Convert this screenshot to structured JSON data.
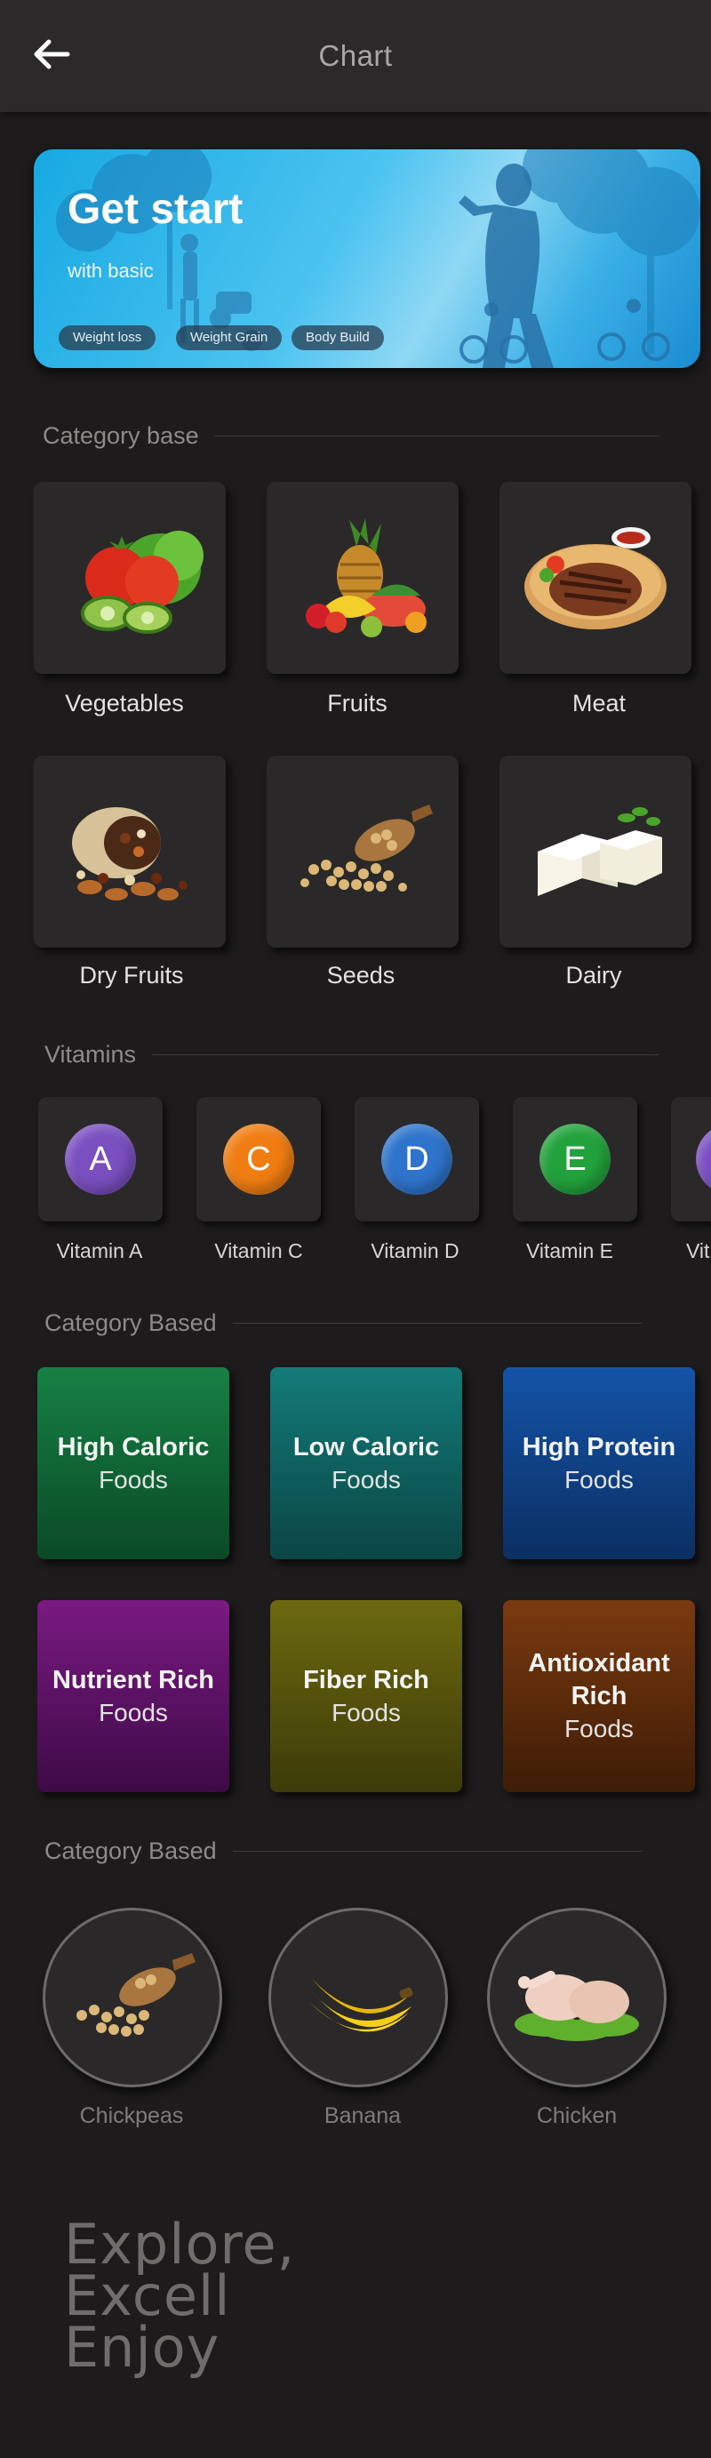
{
  "header": {
    "title": "Chart",
    "back_icon": "arrow-left-icon"
  },
  "banner": {
    "title": "Get start",
    "subtitle": "with basic",
    "chips": [
      "Weight loss",
      "Weight Grain",
      "Body Build"
    ]
  },
  "category_base": {
    "heading": "Category base",
    "items": [
      "Vegetables",
      "Fruits",
      "Meat",
      "Dry Fruits",
      "Seeds",
      "Dairy"
    ]
  },
  "vitamins": {
    "heading": "Vitamins",
    "items": [
      {
        "letter": "A",
        "label": "Vitamin A",
        "color": "#7a4fc0"
      },
      {
        "letter": "C",
        "label": "Vitamin C",
        "color": "#f07d12"
      },
      {
        "letter": "D",
        "label": "Vitamin D",
        "color": "#2f74cc"
      },
      {
        "letter": "E",
        "label": "Vitamin E",
        "color": "#22a23c"
      },
      {
        "letter": "",
        "label": "Vit",
        "color": "#7a4fc0"
      }
    ]
  },
  "category_based_tiles": {
    "heading": "Category Based",
    "tiles": [
      {
        "title": "High Caloric",
        "sub": "Foods",
        "color_top": "#168044",
        "color_bottom": "#0a4a26"
      },
      {
        "title": "Low Caloric",
        "sub": "Foods",
        "color_top": "#137b78",
        "color_bottom": "#0a4645"
      },
      {
        "title": "High Protein",
        "sub": "Foods",
        "color_top": "#1453a8",
        "color_bottom": "#0b2f62"
      },
      {
        "title": "Nutrient Rich",
        "sub": "Foods",
        "color_top": "#7a1a82",
        "color_bottom": "#3d0a45"
      },
      {
        "title": "Fiber Rich",
        "sub": "Foods",
        "color_top": "#6c6910",
        "color_bottom": "#3d3b08"
      },
      {
        "title": "Antioxidant Rich",
        "sub": "Foods",
        "color_top": "#7a3a10",
        "color_bottom": "#3e1c06"
      }
    ]
  },
  "category_based_circles": {
    "heading": "Category Based",
    "items": [
      "Chickpeas",
      "Banana",
      "Chicken"
    ]
  },
  "footer": {
    "lines": [
      "Explore,",
      "Excell",
      "Enjoy"
    ]
  }
}
